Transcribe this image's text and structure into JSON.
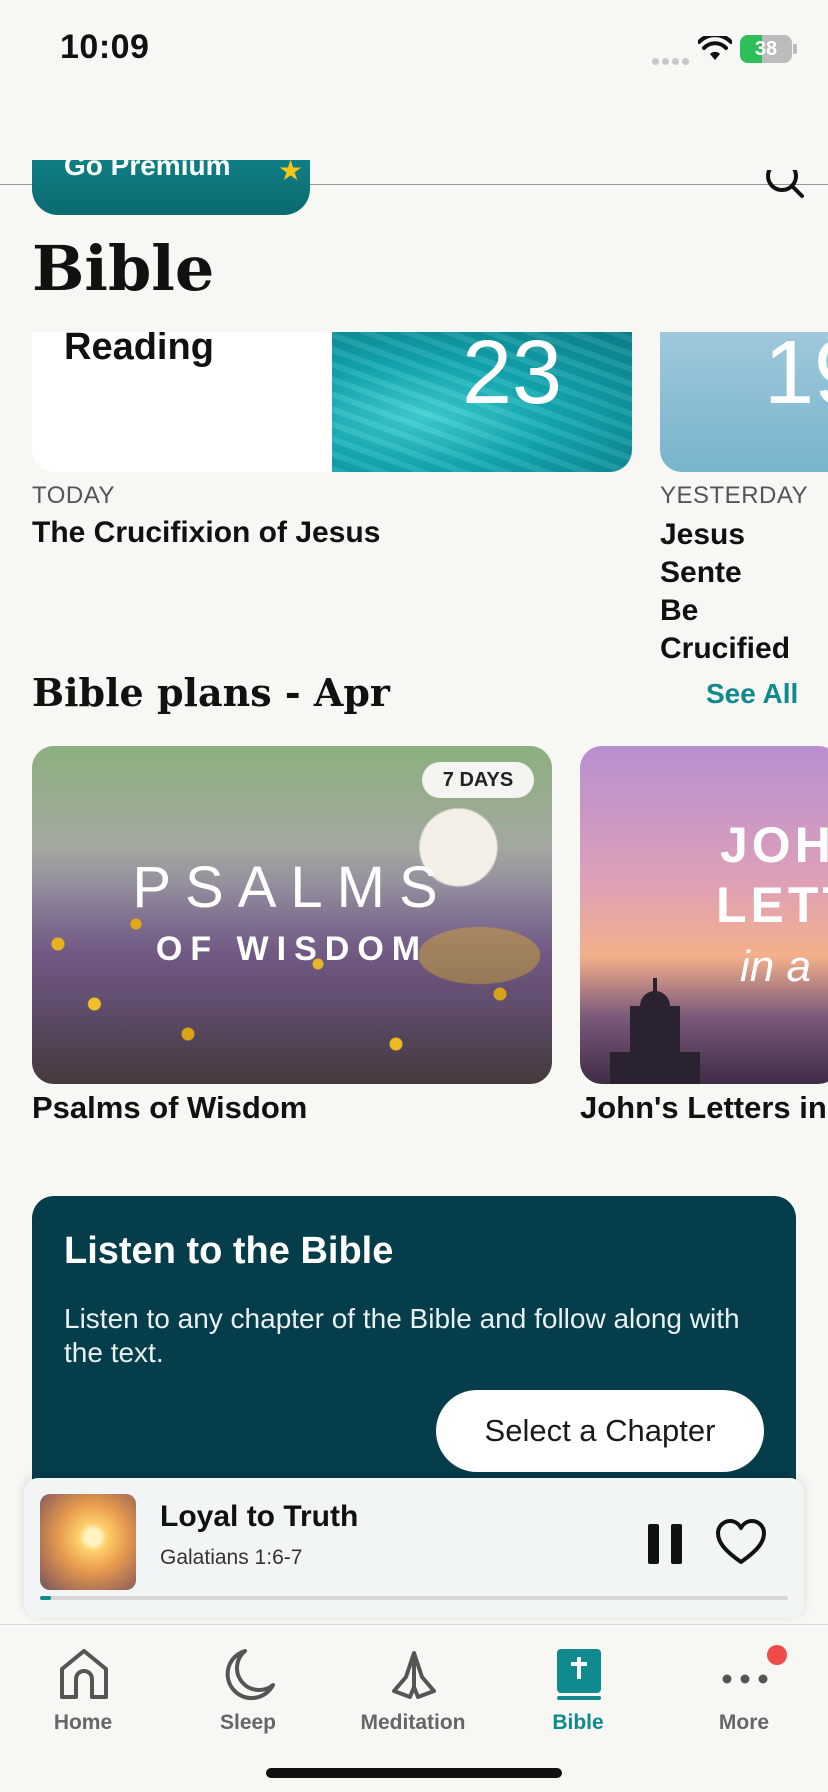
{
  "status_bar": {
    "time": "10:09",
    "battery": "38"
  },
  "header": {
    "premium_label": "Go Premium",
    "title": "Bible"
  },
  "daily": {
    "today_card": {
      "label": "Reading",
      "day": "23",
      "when": "TODAY",
      "title": "The Crucifixion of Jesus"
    },
    "yesterday_card": {
      "day": "19",
      "when": "YESTERDAY",
      "title_line1": "Jesus Sente",
      "title_line2": "Be Crucified"
    }
  },
  "plans": {
    "section_title": "Bible plans - Apr",
    "see_all": "See All",
    "items": [
      {
        "title": "Psalms of Wisdom",
        "badge": "7 DAYS",
        "art_line1": "PSALMS",
        "art_line2": "OF WISDOM"
      },
      {
        "title": "John's Letters in",
        "art_line1": "JOH",
        "art_line2": "LETT",
        "art_line3": "in a"
      }
    ]
  },
  "listen": {
    "title": "Listen to the Bible",
    "description": "Listen to any chapter of the Bible and follow along with the text.",
    "button": "Select a Chapter"
  },
  "player": {
    "title": "Loyal to Truth",
    "subtitle": "Galatians 1:6-7",
    "progress": 0.015
  },
  "tabs": [
    {
      "label": "Home",
      "icon": "home-icon"
    },
    {
      "label": "Sleep",
      "icon": "moon-icon"
    },
    {
      "label": "Meditation",
      "icon": "praying-hands-icon"
    },
    {
      "label": "Bible",
      "icon": "bible-icon",
      "active": true
    },
    {
      "label": "More",
      "icon": "more-icon",
      "badge": true
    }
  ],
  "colors": {
    "accent": "#0f8a8f",
    "listen_bg": "#053d4b",
    "badge_dot": "#f04a4a"
  }
}
